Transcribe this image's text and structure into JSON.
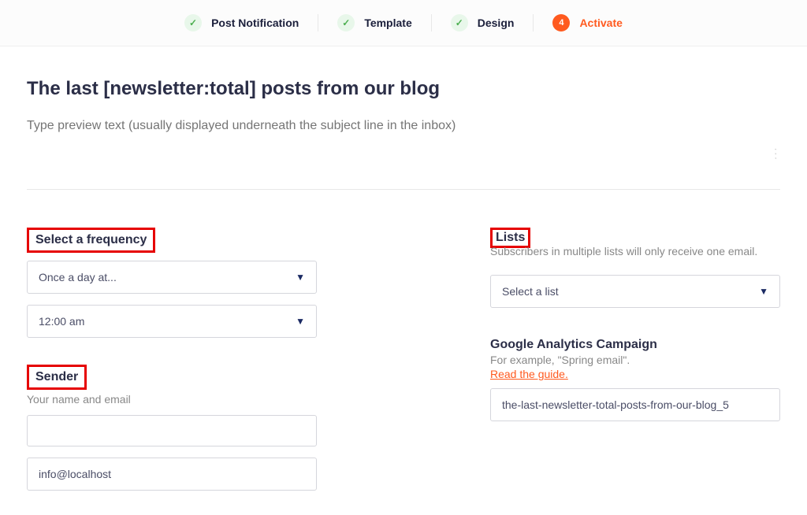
{
  "stepper": {
    "steps": [
      {
        "label": "Post Notification",
        "state": "done"
      },
      {
        "label": "Template",
        "state": "done"
      },
      {
        "label": "Design",
        "state": "done"
      },
      {
        "label": "Activate",
        "state": "active",
        "num": "4"
      }
    ]
  },
  "main": {
    "title": "The last [newsletter:total] posts from our blog",
    "preview_placeholder": "Type preview text (usually displayed underneath the subject line in the inbox)"
  },
  "frequency": {
    "heading": "Select a frequency",
    "select1": "Once a day at...",
    "select2": "12:00 am"
  },
  "sender": {
    "heading": "Sender",
    "sub": "Your name and email",
    "name_value": "",
    "email_value": "info@localhost"
  },
  "lists": {
    "heading": "Lists",
    "sub": "Subscribers in multiple lists will only receive one email.",
    "select_placeholder": "Select a list"
  },
  "analytics": {
    "heading": "Google Analytics Campaign",
    "sub": "For example, \"Spring email\".",
    "guide_link": "Read the guide.",
    "value": "the-last-newsletter-total-posts-from-our-blog_5"
  }
}
